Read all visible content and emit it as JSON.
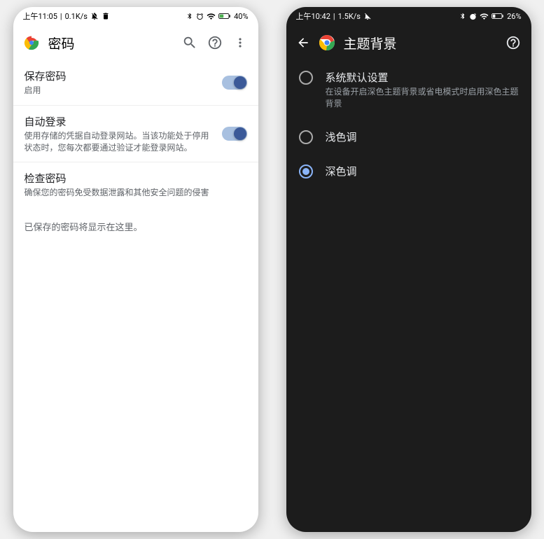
{
  "left": {
    "status": {
      "time": "上午11:05",
      "speed": "0.1K/s",
      "battery": "40%"
    },
    "appbar": {
      "title": "密码"
    },
    "items": [
      {
        "title": "保存密码",
        "desc": "启用",
        "toggle": true
      },
      {
        "title": "自动登录",
        "desc": "使用存储的凭据自动登录网站。当该功能处于停用状态时，您每次都要通过验证才能登录网站。",
        "toggle": true
      },
      {
        "title": "检查密码",
        "desc": "确保您的密码免受数据泄露和其他安全问题的侵害",
        "toggle": false
      }
    ],
    "empty": "已保存的密码将显示在这里。"
  },
  "right": {
    "status": {
      "time": "上午10:42",
      "speed": "1.5K/s",
      "battery": "26%"
    },
    "appbar": {
      "title": "主题背景"
    },
    "options": [
      {
        "title": "系统默认设置",
        "desc": "在设备开启深色主题背景或省电模式时启用深色主题背景",
        "checked": false
      },
      {
        "title": "浅色调",
        "desc": "",
        "checked": false
      },
      {
        "title": "深色调",
        "desc": "",
        "checked": true
      }
    ]
  }
}
